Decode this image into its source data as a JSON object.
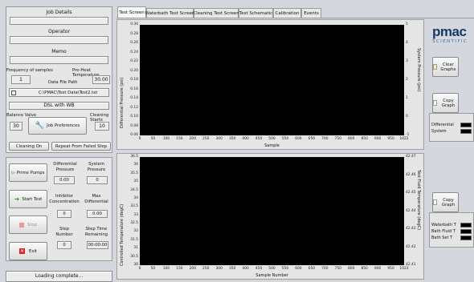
{
  "left": {
    "job_details_label": "Job Details",
    "operator_label": "Operator",
    "memo_label": "Memo",
    "frequency_label": "Frequency of samples",
    "frequency_value": "1",
    "preheat_label": "Pre-Heat Temperature",
    "preheat_value": "30.00",
    "data_file_label": "Data File Path",
    "data_file_value": "C:\\PMAC\\Test Data\\Test2.txt",
    "mode_value": "DSL with WB",
    "balance_valve_label": "Balance Valve",
    "balance_valve_value": "30",
    "job_preferences_label": "Job Preferences",
    "cleaning_starts_label": "Cleaning Starts",
    "cleaning_starts_value": "10",
    "cleaning_on_label": "Cleaning On",
    "repeat_label": "Repeat From Failed Step",
    "prime_pumps_label": "Prime Pumps",
    "start_test_label": "Start Test",
    "stop_label": "Stop",
    "exit_label": "Exit",
    "diff_pressure_label": "Differential Pressure",
    "diff_pressure_value": "0.00",
    "system_pressure_label": "System Pressure",
    "system_pressure_value": "0",
    "inhibitor_label": "Inhibitor Concentration",
    "inhibitor_value": "0",
    "max_diff_label": "Max Differential",
    "max_diff_value": "0.00",
    "step_number_label": "Step Number",
    "step_number_value": "0",
    "step_time_label": "Step Time Remaining",
    "step_time_value": "00:00:00",
    "status_text": "Loading complete..."
  },
  "tabs": [
    "Test Screen",
    "Waterbath Test Screen",
    "Cleaning Test Screen",
    "Test Schematic",
    "Calibration",
    "Events"
  ],
  "top_chart": {
    "ylabel_left": "Differential Pressure (psi)",
    "ylabel_right": "System Pressure (psi)",
    "xlabel": "Sample",
    "y_ticks": [
      "0.30",
      "0.28",
      "0.26",
      "0.24",
      "0.22",
      "0.20",
      "0.18",
      "0.16",
      "0.14",
      "0.12",
      "0.10",
      "0.08",
      "0.06"
    ],
    "y2_ticks": [
      "5",
      "4",
      "3",
      "2",
      "1",
      "0",
      "-1"
    ],
    "x_ticks": [
      "0",
      "50",
      "100",
      "150",
      "200",
      "250",
      "300",
      "350",
      "400",
      "450",
      "500",
      "550",
      "600",
      "650",
      "700",
      "750",
      "800",
      "850",
      "900",
      "950",
      "1022"
    ]
  },
  "bottom_chart": {
    "ylabel_left": "Controlled Temperature (degC)",
    "ylabel_right": "Test Fluid Temperature (degC)",
    "xlabel": "Sample Number",
    "y_ticks": [
      "36.5",
      "36",
      "35.5",
      "35",
      "34.5",
      "34",
      "33.5",
      "33",
      "32.5",
      "32",
      "31.5",
      "31",
      "30.5",
      "30"
    ],
    "y2_ticks": [
      "42.47",
      "42.46",
      "42.45",
      "42.44",
      "42.43",
      "42.42",
      "42.41"
    ],
    "x_ticks": [
      "0",
      "50",
      "100",
      "150",
      "200",
      "250",
      "300",
      "350",
      "400",
      "450",
      "500",
      "550",
      "600",
      "650",
      "700",
      "750",
      "800",
      "850",
      "900",
      "950",
      "1023"
    ]
  },
  "right": {
    "logo_text": "pmac",
    "logo_sub": "SCIENTIFIC",
    "clear_graphs_label": "Clear Graphs",
    "copy_graph_label": "Copy Graph",
    "copy_graph2_label": "Copy Graph",
    "legend_top": [
      "Differential",
      "System"
    ],
    "legend_bottom": [
      "Waterbath T",
      "Bath Fluid T",
      "Bath Set T"
    ]
  }
}
